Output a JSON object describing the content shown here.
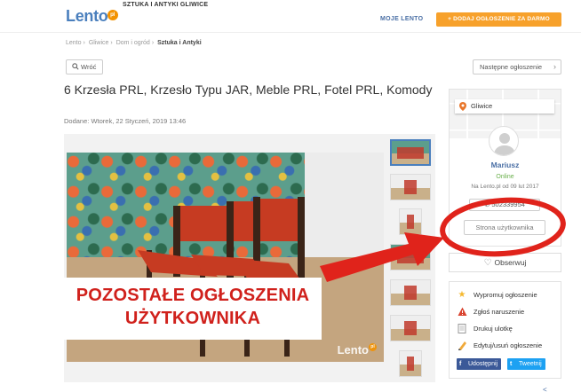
{
  "header": {
    "logo_text": "Lento",
    "logo_badge": "pl",
    "site_subtitle": "SZTUKA I ANTYKI GLIWICE",
    "my_account_label": "MOJE LENTO",
    "add_ad_label": "+ DODAJ OGŁOSZENIE ZA DARMO"
  },
  "breadcrumb": {
    "items": [
      "Lento",
      "Gliwice",
      "Dom i ogród"
    ],
    "current": "Sztuka i Antyki"
  },
  "nav": {
    "back_label": "Wróć",
    "next_label": "Następne ogłoszenie",
    "next_icon": "chevron-right-icon"
  },
  "listing": {
    "title": "6 Krzesła PRL, Krzesło Typu JAR, Meble PRL, Fotel PRL, Komody",
    "date": "Dodane: Wtorek, 22 Styczeń, 2019  13:46"
  },
  "gallery": {
    "watermark": "Lento",
    "watermark_badge": "pl",
    "thumbnail_count": 8
  },
  "overlay": {
    "promo_line1": "POZOSTAŁE OGŁOSZENIA",
    "promo_line2": "UŻYTKOWNIKA",
    "annotation_color": "#e0231b"
  },
  "seller": {
    "location": "Gliwice",
    "name": "Mariusz",
    "status": "Online",
    "member_since": "Na Lento.pl od 09 lut 2017",
    "phone_partial": "502339954",
    "user_page_label": "Strona użytkownika",
    "follow_label": "Obserwuj"
  },
  "actions": {
    "promote_label": "Wypromuj ogłoszenie",
    "report_label": "Zgłoś naruszenie",
    "print_label": "Drukuj ulotkę",
    "edit_label": "Edytuj/usuń ogłoszenie",
    "facebook_label": "Udostępnij",
    "twitter_label": "Tweetnij"
  },
  "colors": {
    "brand_blue": "#4a7fbd",
    "accent_orange": "#f7a12b",
    "promo_red": "#d0211c",
    "online_green": "#6ab04c"
  }
}
